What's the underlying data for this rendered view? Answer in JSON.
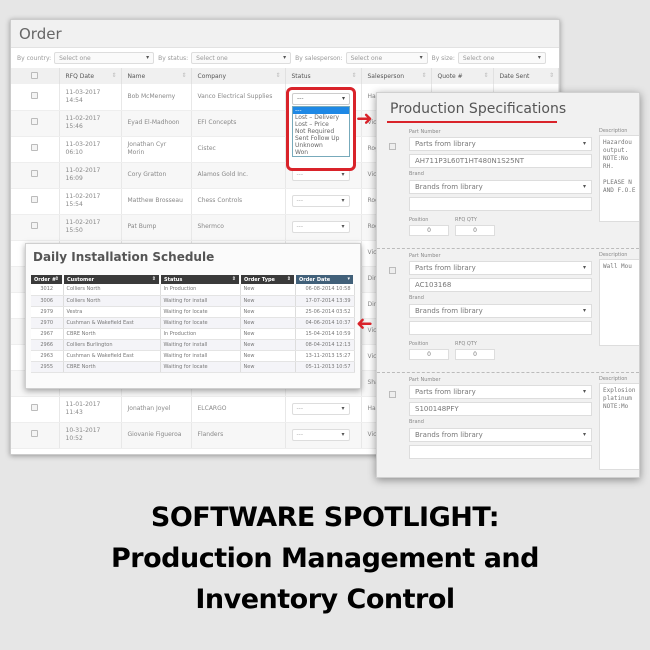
{
  "order": {
    "title": "Order",
    "filters": [
      {
        "label": "By country:",
        "value": "Select one"
      },
      {
        "label": "By status:",
        "value": "Select one"
      },
      {
        "label": "By salesperson:",
        "value": "Select one"
      },
      {
        "label": "By size:",
        "value": "Select one"
      }
    ],
    "columns": [
      "RFQ Date",
      "Name",
      "Company",
      "Status",
      "Salesperson",
      "Quote #",
      "Date Sent"
    ],
    "rows": [
      {
        "date": "11-03-2017",
        "time": "14:54",
        "name": "Bob McMenemy",
        "company": "Vanco Electrical Supplies",
        "status": "---",
        "salesperson": "Hard"
      },
      {
        "date": "11-02-2017",
        "time": "15:46",
        "name": "Eyad El-Madhoon",
        "company": "EFI Concepts",
        "status": "---",
        "salesperson": "Vick"
      },
      {
        "date": "11-03-2017",
        "time": "06:10",
        "name": "Jonathan Cyr Morin",
        "company": "Cistec",
        "status": "---",
        "salesperson": "Roge"
      },
      {
        "date": "11-02-2017",
        "time": "16:09",
        "name": "Cory Gratton",
        "company": "Alamos Gold Inc.",
        "status": "---",
        "salesperson": "Vick"
      },
      {
        "date": "11-02-2017",
        "time": "15:54",
        "name": "Matthew Brosseau",
        "company": "Chess Controls",
        "status": "---",
        "salesperson": "Roge"
      },
      {
        "date": "11-02-2017",
        "time": "15:50",
        "name": "Pat Bump",
        "company": "Shermco",
        "status": "---",
        "salesperson": "Roge"
      },
      {
        "date": "",
        "time": "",
        "name": "",
        "company": "",
        "status": "",
        "salesperson": "Vick"
      },
      {
        "date": "",
        "time": "",
        "name": "",
        "company": "",
        "status": "",
        "salesperson": "Dirk"
      },
      {
        "date": "",
        "time": "",
        "name": "",
        "company": "",
        "status": "",
        "salesperson": "Dirk"
      },
      {
        "date": "",
        "time": "",
        "name": "",
        "company": "",
        "status": "",
        "salesperson": "Vick"
      },
      {
        "date": "",
        "time": "",
        "name": "",
        "company": "",
        "status": "",
        "salesperson": "Vick"
      },
      {
        "date": "",
        "time": "",
        "name": "",
        "company": "",
        "status": "",
        "salesperson": "Shav"
      },
      {
        "date": "11-01-2017",
        "time": "11:43",
        "name": "Jonathan Joyel",
        "company": "ELCARGO",
        "status": "---",
        "salesperson": "Hard"
      },
      {
        "date": "10-31-2017",
        "time": "10:52",
        "name": "Giovanie Figueroa",
        "company": "Flanders",
        "status": "---",
        "salesperson": "Vick"
      }
    ],
    "status_dropdown": {
      "current": "---",
      "options": [
        "---",
        "Lost – Delivery",
        "Lost – Price",
        "Not Required",
        "Sent Follow Up",
        "Unknown",
        "Won"
      ],
      "selected_index": 0
    }
  },
  "schedule": {
    "title": "Daily Installation Schedule",
    "columns": [
      "Order #",
      "Customer",
      "Status",
      "Order Type",
      "Order Date"
    ],
    "rows": [
      {
        "order": "3012",
        "customer": "Colliers North",
        "status": "In Production",
        "type": "New",
        "date": "06-08-2014 10:58"
      },
      {
        "order": "3006",
        "customer": "Colliers North",
        "status": "Waiting for install",
        "type": "New",
        "date": "17-07-2014 13:39"
      },
      {
        "order": "2979",
        "customer": "Vestra",
        "status": "Waiting for locate",
        "type": "New",
        "date": "25-06-2014 03:52"
      },
      {
        "order": "2970",
        "customer": "Cushman & Wakefield East",
        "status": "Waiting for locate",
        "type": "New",
        "date": "04-06-2014 10:37"
      },
      {
        "order": "2967",
        "customer": "CBRE North",
        "status": "In Production",
        "type": "New",
        "date": "15-04-2014 10:59"
      },
      {
        "order": "2966",
        "customer": "Colliers Burlington",
        "status": "Waiting for install",
        "type": "New",
        "date": "08-04-2014 12:13"
      },
      {
        "order": "2963",
        "customer": "Cushman & Wakefield East",
        "status": "Waiting for install",
        "type": "New",
        "date": "13-11-2013 15:27"
      },
      {
        "order": "2955",
        "customer": "CBRE North",
        "status": "Waiting for locate",
        "type": "New",
        "date": "05-11-2013 10:57"
      }
    ]
  },
  "specs": {
    "title": "Production Specifications",
    "labels": {
      "part_number": "Part Number",
      "brand": "Brand",
      "position": "Position",
      "rfq_qty": "RFQ QTY",
      "description": "Description"
    },
    "parts": [
      {
        "part_select": "Parts from library",
        "part_number": "AH711P3L60T1HT480N1S25NT",
        "brand_select": "Brands from library",
        "brand": "",
        "position": "0",
        "rfq_qty": "0",
        "description": "Hazardou\noutput.\nNOTE:No\nRH.\n\nPLEASE N\nAND F.O.E"
      },
      {
        "part_select": "Parts from library",
        "part_number": "AC103168",
        "brand_select": "Brands from library",
        "brand": "",
        "position": "0",
        "rfq_qty": "0",
        "description": "Wall Mou"
      },
      {
        "part_select": "Parts from library",
        "part_number": "S100148PFY",
        "brand_select": "Brands from library",
        "brand": "",
        "position": "",
        "rfq_qty": "",
        "description": "Explosion\nplatinum\nNOTE:Mo"
      }
    ]
  },
  "caption": {
    "line1": "SOFTWARE SPOTLIGHT:",
    "line2": "Production Management and",
    "line3": "Inventory Control"
  },
  "colors": {
    "accent_red": "#d9232a",
    "header_dark": "#3a3a3a",
    "header_active": "#416079",
    "selected_blue": "#1e88e5"
  }
}
